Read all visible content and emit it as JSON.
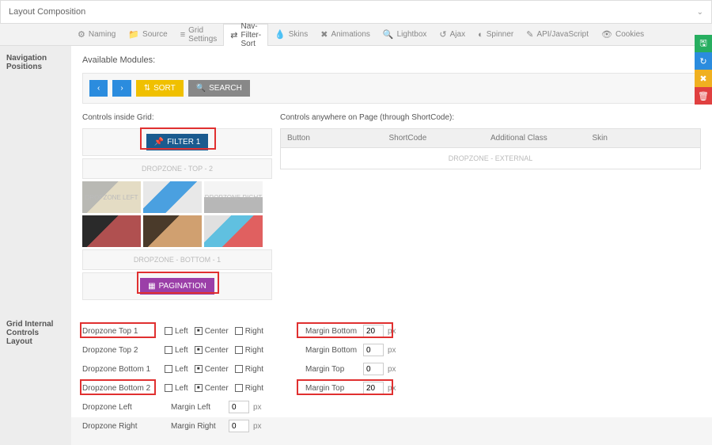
{
  "header": {
    "title": "Layout Composition"
  },
  "tabs": [
    {
      "icon": "⚙",
      "label": "Naming"
    },
    {
      "icon": "📁",
      "label": "Source"
    },
    {
      "icon": "≡",
      "label": "Grid Settings"
    },
    {
      "icon": "⇄",
      "label": "Nav-Filter-Sort"
    },
    {
      "icon": "💧",
      "label": "Skins"
    },
    {
      "icon": "✖",
      "label": "Animations"
    },
    {
      "icon": "🔍",
      "label": "Lightbox"
    },
    {
      "icon": "↺",
      "label": "Ajax"
    },
    {
      "icon": "◐",
      "label": "Spinner"
    },
    {
      "icon": "✎",
      "label": "API/JavaScript"
    },
    {
      "icon": "👁",
      "label": "Cookies"
    }
  ],
  "active_tab_index": 3,
  "sidebar": {
    "nav_positions": "Navigation Positions",
    "grid_internal": "Grid Internal Controls Layout"
  },
  "nav": {
    "available_modules": "Available Modules:",
    "buttons": {
      "prev": "‹",
      "next": "›",
      "sort": "SORT",
      "search": "SEARCH"
    },
    "controls_inside": "Controls inside Grid:",
    "controls_anywhere": "Controls anywhere on Page (through ShortCode):",
    "filter1": "FILTER 1",
    "dz_top2": "DROPZONE - TOP - 2",
    "dz_left": "DROPZONE LEFT",
    "dz_right": "DROPZONE RIGHT",
    "dz_bottom1": "DROPZONE - BOTTOM - 1",
    "pagination": "PAGINATION",
    "ext_headers": {
      "button": "Button",
      "shortcode": "ShortCode",
      "class": "Additional Class",
      "skin": "Skin"
    },
    "dz_external": "DROPZONE - EXTERNAL"
  },
  "controls": {
    "left": "Left",
    "center": "Center",
    "right": "Right",
    "rows": [
      {
        "name": "Dropzone Top 1",
        "align": "center",
        "margin_label": "Margin Bottom",
        "margin_value": "20",
        "highlight": true
      },
      {
        "name": "Dropzone Top 2",
        "align": "center",
        "margin_label": "Margin Bottom",
        "margin_value": "0",
        "highlight": false
      },
      {
        "name": "Dropzone Bottom 1",
        "align": "center",
        "margin_label": "Margin Top",
        "margin_value": "0",
        "highlight": false
      },
      {
        "name": "Dropzone Bottom 2",
        "align": "center",
        "margin_label": "Margin Top",
        "margin_value": "20",
        "highlight": true
      },
      {
        "name": "Dropzone Left",
        "margin_only": true,
        "margin_label": "Margin Left",
        "margin_value": "0"
      },
      {
        "name": "Dropzone Right",
        "margin_only": true,
        "margin_label": "Margin Right",
        "margin_value": "0"
      }
    ],
    "unit": "px"
  }
}
